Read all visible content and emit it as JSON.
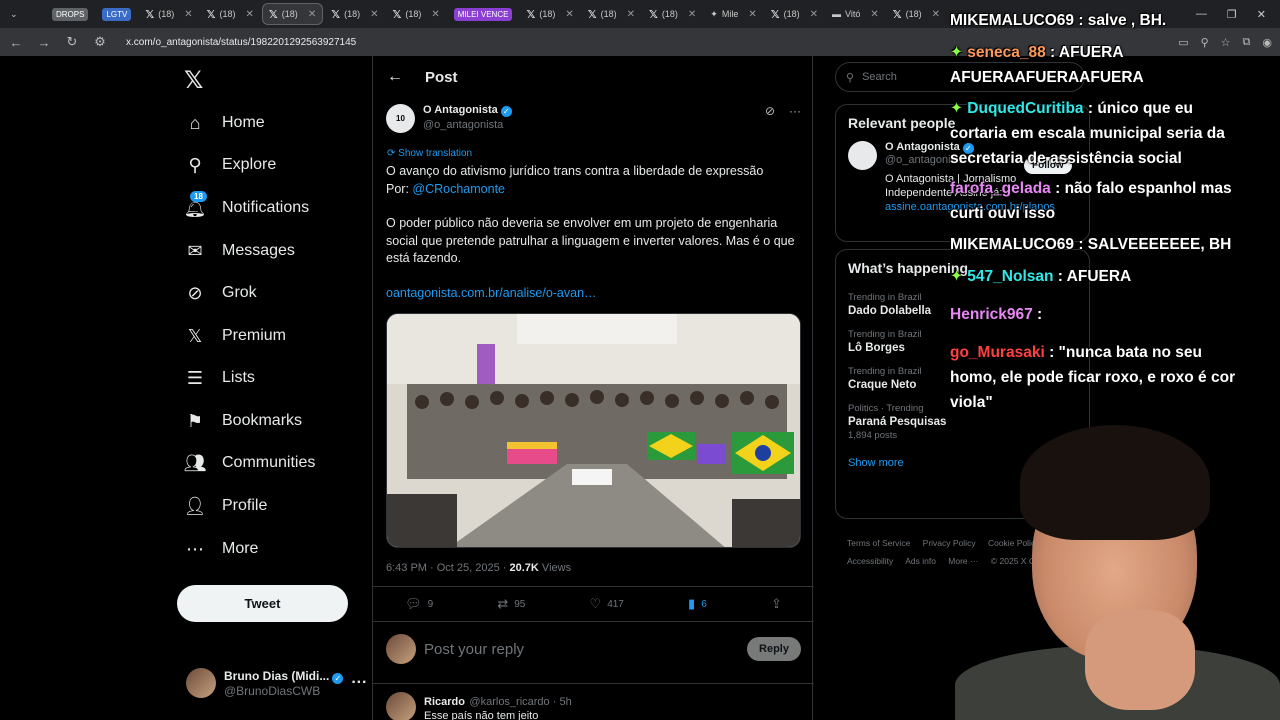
{
  "browser": {
    "tabs": [
      {
        "label": "DROPS",
        "kind": "pill"
      },
      {
        "label": "LGTV",
        "kind": "pill"
      },
      {
        "label": "(18)"
      },
      {
        "label": "(18)"
      },
      {
        "label": "(18)",
        "active": true
      },
      {
        "label": "(18)"
      },
      {
        "label": "(18)"
      },
      {
        "label": "MILEI VENCE",
        "kind": "pill"
      },
      {
        "label": "(18)"
      },
      {
        "label": "(18)"
      },
      {
        "label": "(18)"
      },
      {
        "label": "Mile"
      },
      {
        "label": "(18)"
      },
      {
        "label": "Vitó"
      },
      {
        "label": "(18)"
      }
    ],
    "url": "x.com/o_antagonista/status/1982201292563927145"
  },
  "nav": {
    "items": [
      {
        "label": "Home",
        "icon": "home-icon",
        "glyph": "⌂"
      },
      {
        "label": "Explore",
        "icon": "search-icon",
        "glyph": "⚲"
      },
      {
        "label": "Notifications",
        "icon": "bell-icon",
        "glyph": "🔔︎",
        "badge": "18"
      },
      {
        "label": "Messages",
        "icon": "mail-icon",
        "glyph": "✉"
      },
      {
        "label": "Grok",
        "icon": "grok-icon",
        "glyph": "⊘"
      },
      {
        "label": "Premium",
        "icon": "x-logo-icon",
        "glyph": "𝕏"
      },
      {
        "label": "Lists",
        "icon": "list-icon",
        "glyph": "☰"
      },
      {
        "label": "Bookmarks",
        "icon": "bookmark-icon",
        "glyph": "⚑"
      },
      {
        "label": "Communities",
        "icon": "people-icon",
        "glyph": "👥︎"
      },
      {
        "label": "Profile",
        "icon": "person-icon",
        "glyph": "👤︎"
      },
      {
        "label": "More",
        "icon": "more-circle-icon",
        "glyph": "⋯"
      }
    ],
    "tweet_label": "Tweet",
    "me": {
      "name": "Bruno Dias (Midi...",
      "handle": "@BrunoDiasCWB"
    }
  },
  "post": {
    "header_title": "Post",
    "author_name": "O Antagonista",
    "author_handle": "@o_antagonista",
    "show_translation": "Show translation",
    "line1": "O avanço do ativismo jurídico trans contra a liberdade de expressão",
    "line2_prefix": "Por: ",
    "line2_mention": "@CRochamonte",
    "para2": "O poder público não deveria se envolver em um  projeto de engenharia social que pretende patrulhar a linguagem e inverter valores. Mas é o que está fazendo.",
    "link": "oantagonista.com.br/analise/o-avan…",
    "timestamp": "6:43 PM · Oct 25, 2025 · ",
    "views_count": "20.7K",
    "views_label": " Views",
    "replies": "9",
    "reposts": "95",
    "likes": "417",
    "bookmarks": "6",
    "reply_placeholder": "Post your reply",
    "reply_button": "Reply",
    "comment": {
      "name": "Ricardo",
      "handle": "@karlos_ricardo · 5h",
      "text": "Esse país não tem jeito"
    }
  },
  "sidebar": {
    "search_placeholder": "Search",
    "relevant_title": "Relevant people",
    "relevant": {
      "name": "O Antagonista",
      "handle": "@o_antagonista",
      "bio": "O Antagonista | Jornalismo Independente Assine já:",
      "bio_link": "assine.oantagonista.com.br/planos",
      "follow": "Follow"
    },
    "happening_title": "What’s happening",
    "trends": [
      {
        "context": "Trending in Brazil",
        "name": "Dado Dolabella",
        "count": ""
      },
      {
        "context": "Trending in Brazil",
        "name": "Lô Borges",
        "count": ""
      },
      {
        "context": "Trending in Brazil",
        "name": "Craque Neto",
        "count": ""
      },
      {
        "context": "Politics · Trending",
        "name": "Paraná Pesquisas",
        "count": "1,894 posts"
      }
    ],
    "show_more": "Show more",
    "footer": [
      "Terms of Service",
      "Privacy Policy",
      "Cookie Policy",
      "Accessibility",
      "Ads info",
      "More ···",
      "© 2025 X Corp."
    ]
  },
  "chat": [
    {
      "user": "MIKEMALUCO69",
      "text": " : salve , BH."
    },
    {
      "user": "seneca_88",
      "text": " : AFUERA AFUERAAFUERAAFUERA"
    },
    {
      "user": "DuquedCuritiba",
      "text": " : único que eu cortaria em escala municipal seria da secretaria de assistência social"
    },
    {
      "user": "farofa_gelada",
      "text": " : não falo espanhol mas curti ouvi isso"
    },
    {
      "user": "MIKEMALUCO69",
      "text": " : SALVEEEEEEE, BH"
    },
    {
      "user": "547_Nolsan",
      "text": " : AFUERA"
    },
    {
      "user": "Henrick967",
      "text": " :"
    },
    {
      "user": "go_Murasaki",
      "text": " : \"nunca bata no seu homo, ele pode ficar roxo, e roxo é cor viola\""
    }
  ]
}
